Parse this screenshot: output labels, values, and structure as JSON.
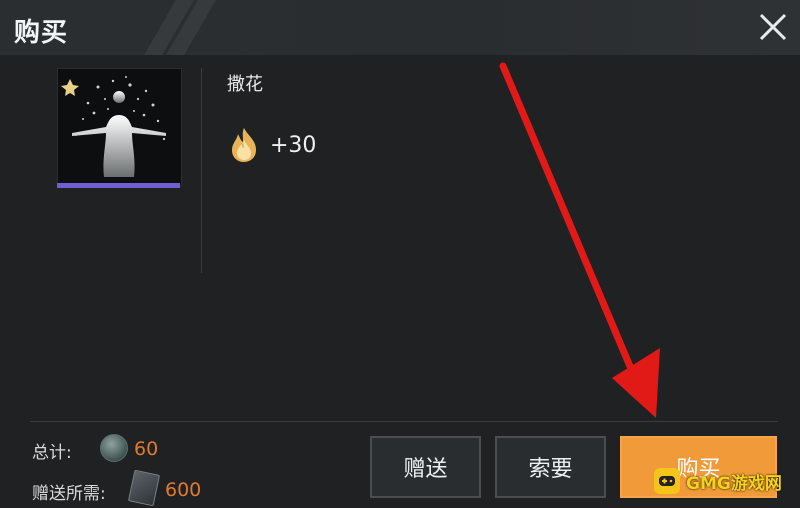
{
  "dialog": {
    "title": "购买",
    "close_icon": "close-icon"
  },
  "item": {
    "name": "撒花",
    "thumbnail_icon": "confetti-emote-figure",
    "rarity_color": "#6e5fd3",
    "heat_icon": "flame-icon",
    "heat_bonus": "+30"
  },
  "footer": {
    "total_label": "总计:",
    "total_currency_icon": "coin-icon",
    "total_value": "60",
    "gift_required_label": "赠送所需:",
    "gift_currency_icon": "voucher-icon",
    "gift_value": "600",
    "price_color": "#e07b2e"
  },
  "buttons": {
    "gift_label": "赠送",
    "request_label": "索要",
    "buy_label": "购买",
    "buy_color": "#f09a3a"
  },
  "annotation": {
    "arrow_color": "#e11a17"
  },
  "watermark": {
    "text": "GMG游戏网",
    "icon": "gamepad-icon"
  }
}
